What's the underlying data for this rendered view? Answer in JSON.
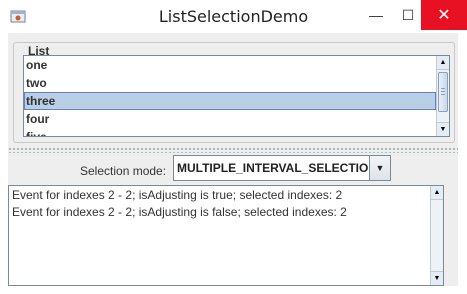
{
  "window": {
    "title": "ListSelectionDemo",
    "controls": {
      "minimize": "—",
      "maximize": "☐",
      "close": "✕"
    },
    "accent": "#e81123"
  },
  "list_panel": {
    "label": "List",
    "items": [
      {
        "label": "one"
      },
      {
        "label": "two"
      },
      {
        "label": "three",
        "selected": true
      },
      {
        "label": "four"
      },
      {
        "label": "five"
      }
    ],
    "selection_color": "#b8cfe5"
  },
  "controls": {
    "selection_mode_label": "Selection mode:",
    "selection_mode_value": "MULTIPLE_INTERVAL_SELECTION",
    "dropdown_arrow": "▼"
  },
  "log": {
    "lines": [
      "Event for indexes 2 - 2; isAdjusting is true; selected indexes: 2",
      "Event for indexes 2 - 2; isAdjusting is false; selected indexes: 2"
    ]
  },
  "scroll": {
    "up": "▲",
    "down": "▼"
  }
}
